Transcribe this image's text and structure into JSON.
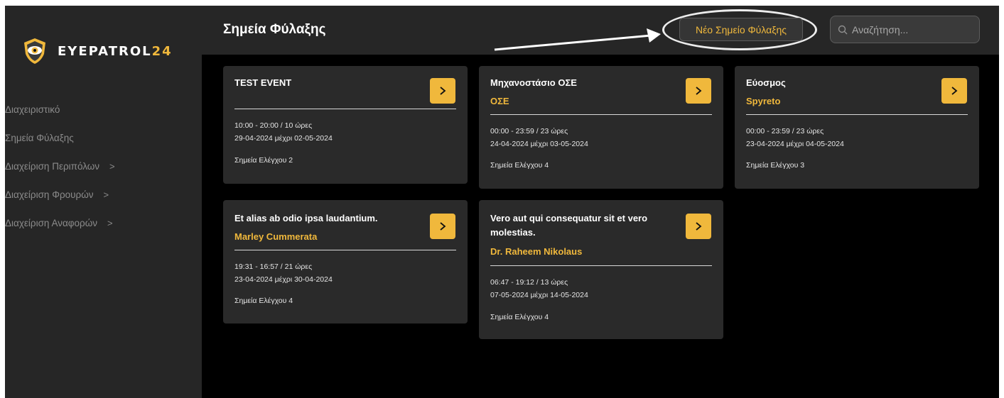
{
  "app": {
    "logo": {
      "text_main": "EYEPATROL",
      "text_accent": "24"
    }
  },
  "sidebar": {
    "items": [
      {
        "label": "Διαχειριστικό",
        "has_chevron": false
      },
      {
        "label": "Σημεία Φύλαξης",
        "has_chevron": false
      },
      {
        "label": "Διαχείριση Περιπόλων",
        "has_chevron": true
      },
      {
        "label": "Διαχείριση Φρουρών",
        "has_chevron": true
      },
      {
        "label": "Διαχείριση Αναφορών",
        "has_chevron": true
      }
    ],
    "chevron": ">"
  },
  "header": {
    "title": "Σημεία Φύλαξης",
    "new_button_label": "Νέο Σημείο Φύλαξης",
    "search_placeholder": "Αναζήτηση..."
  },
  "colors": {
    "accent": "#f0b83c",
    "panel": "#2a2a2a",
    "bar": "#262626",
    "background": "#000000"
  },
  "cards": [
    {
      "title": "TEST EVENT",
      "subtitle": "",
      "time": "10:00 - 20:00 / 10 ώρες",
      "dates": "29-04-2024 μέχρι 02-05-2024",
      "checkpoints": "Σημεία Ελέγχου 2"
    },
    {
      "title": "Μηχανοστάσιο ΟΣΕ",
      "subtitle": "ΟΣΕ",
      "time": "00:00 - 23:59 / 23 ώρες",
      "dates": "24-04-2024 μέχρι 03-05-2024",
      "checkpoints": "Σημεία Ελέγχου 4"
    },
    {
      "title": "Εύοσμος",
      "subtitle": "Spyreto",
      "time": "00:00 - 23:59 / 23 ώρες",
      "dates": "23-04-2024 μέχρι 04-05-2024",
      "checkpoints": "Σημεία Ελέγχου 3"
    },
    {
      "title": "Et alias ab odio ipsa laudantium.",
      "subtitle": "Marley Cummerata",
      "time": "19:31 - 16:57 / 21 ώρες",
      "dates": "23-04-2024 μέχρι 30-04-2024",
      "checkpoints": "Σημεία Ελέγχου 4"
    },
    {
      "title_line1": "Vero aut qui consequatur sit et vero",
      "title_line2": "molestias.",
      "subtitle": "Dr. Raheem Nikolaus",
      "time": "06:47 - 19:12 / 13 ώρες",
      "dates": "07-05-2024 μέχρι 14-05-2024",
      "checkpoints": "Σημεία Ελέγχου 4"
    }
  ]
}
